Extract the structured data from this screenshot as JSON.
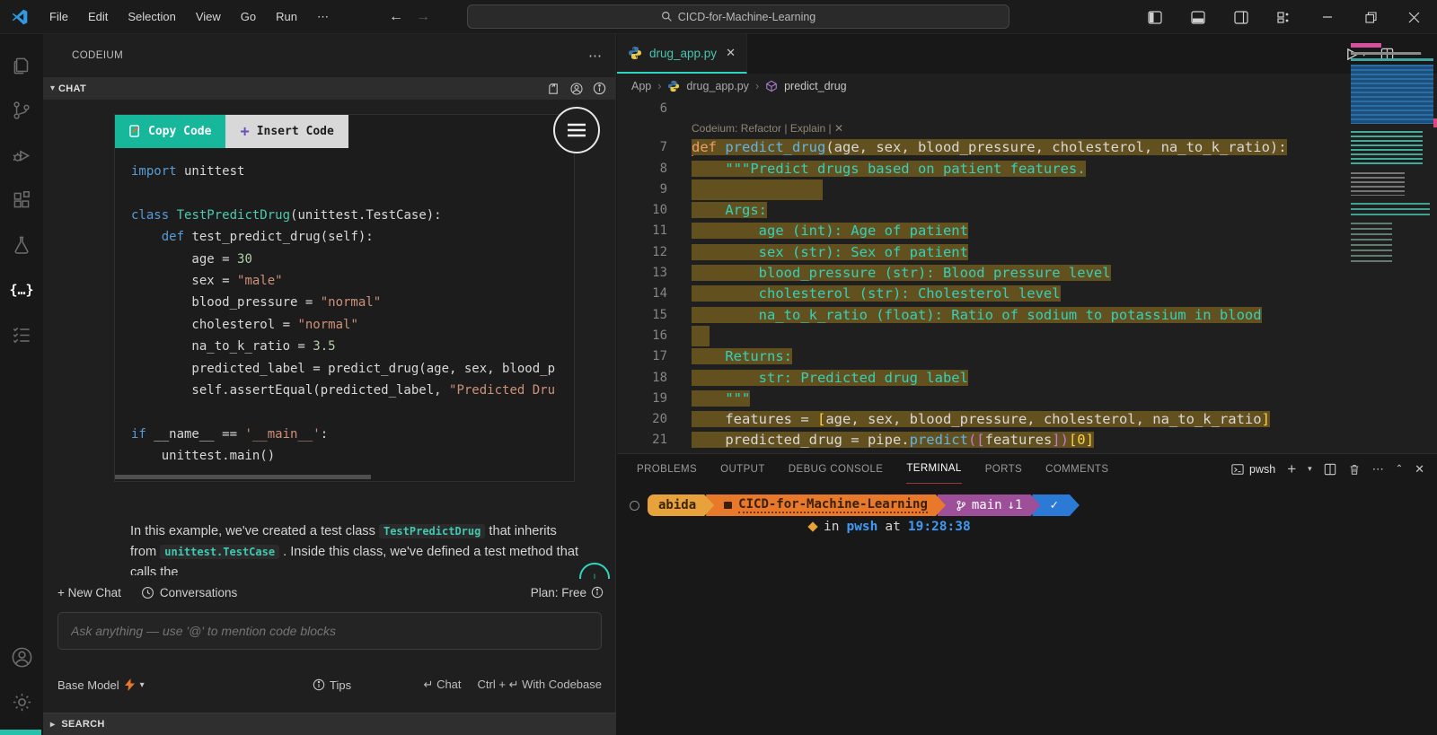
{
  "titlebar": {
    "menus": [
      "File",
      "Edit",
      "Selection",
      "View",
      "Go",
      "Run"
    ],
    "overflow": "⋯",
    "search_text": "CICD-for-Machine-Learning"
  },
  "sidebar": {
    "title": "CODEIUM",
    "section_label": "CHAT",
    "code_card": {
      "copy_label": "Copy Code",
      "insert_label": "Insert Code",
      "lines": [
        {
          "parts": [
            [
              "kw",
              "import"
            ],
            [
              "pl",
              " unittest"
            ]
          ]
        },
        {
          "parts": []
        },
        {
          "parts": [
            [
              "kw",
              "class"
            ],
            [
              "pl",
              " "
            ],
            [
              "cls",
              "TestPredictDrug"
            ],
            [
              "pl",
              "(unittest.TestCase):"
            ]
          ]
        },
        {
          "parts": [
            [
              "pl",
              "    "
            ],
            [
              "kw",
              "def"
            ],
            [
              "pl",
              " test_predict_drug(self):"
            ]
          ]
        },
        {
          "parts": [
            [
              "pl",
              "        age = "
            ],
            [
              "num",
              "30"
            ]
          ]
        },
        {
          "parts": [
            [
              "pl",
              "        sex = "
            ],
            [
              "str",
              "\"male\""
            ]
          ]
        },
        {
          "parts": [
            [
              "pl",
              "        blood_pressure = "
            ],
            [
              "str",
              "\"normal\""
            ]
          ]
        },
        {
          "parts": [
            [
              "pl",
              "        cholesterol = "
            ],
            [
              "str",
              "\"normal\""
            ]
          ]
        },
        {
          "parts": [
            [
              "pl",
              "        na_to_k_ratio = "
            ],
            [
              "num",
              "3.5"
            ]
          ]
        },
        {
          "parts": [
            [
              "pl",
              "        predicted_label = predict_drug(age, sex, blood_p"
            ]
          ]
        },
        {
          "parts": [
            [
              "pl",
              "        self.assertEqual(predicted_label, "
            ],
            [
              "str",
              "\"Predicted Dru"
            ]
          ]
        },
        {
          "parts": []
        },
        {
          "parts": [
            [
              "kw",
              "if"
            ],
            [
              "pl",
              " __name__ == "
            ],
            [
              "str",
              "'__main__'"
            ],
            [
              "pl",
              ":"
            ]
          ]
        },
        {
          "parts": [
            [
              "pl",
              "    unittest.main()"
            ]
          ]
        }
      ]
    },
    "explanation": [
      {
        "code": false,
        "text": "In this example, we've created a test class "
      },
      {
        "code": true,
        "text": "TestPredictDrug"
      },
      {
        "code": false,
        "text": " that inherits from "
      },
      {
        "code": true,
        "text": "unittest.TestCase"
      },
      {
        "code": false,
        "text": " . Inside this class, we've defined a test method that calls the"
      }
    ],
    "footer": {
      "new_chat": "+ New Chat",
      "conversations": "Conversations",
      "plan": "Plan: Free"
    },
    "input_placeholder": "Ask anything — use '@' to mention code blocks",
    "bottom": {
      "model": "Base Model",
      "tips": "Tips",
      "chat": "Chat",
      "ctrl": "Ctrl +",
      "with_codebase": "With Codebase"
    },
    "search_section": "SEARCH"
  },
  "editor": {
    "tab_label": "drug_app.py",
    "breadcrumb": {
      "root": "App",
      "file": "drug_app.py",
      "symbol": "predict_drug"
    },
    "codelens": "Codeium: Refactor | Explain | ✕",
    "lines": [
      {
        "n": 6,
        "parts": []
      },
      {
        "n": 7,
        "lens": true,
        "hl": true,
        "cursor": true,
        "parts": [
          [
            "okw",
            "def"
          ],
          [
            "pl",
            " "
          ],
          [
            "fn",
            "predict_drug"
          ],
          [
            "pl",
            "(age, sex, blood_pressure, cholesterol, na_to_k_ratio):"
          ]
        ]
      },
      {
        "n": 8,
        "hl": true,
        "parts": [
          [
            "pl",
            "    "
          ],
          [
            "doc",
            "\"\"\"Predict drugs based on patient features."
          ]
        ]
      },
      {
        "n": 9,
        "hl": true,
        "block": 146,
        "parts": []
      },
      {
        "n": 10,
        "hl": true,
        "parts": [
          [
            "pl",
            "    "
          ],
          [
            "doc",
            "Args:"
          ]
        ]
      },
      {
        "n": 11,
        "hl": true,
        "parts": [
          [
            "pl",
            "        "
          ],
          [
            "doc",
            "age (int): Age of patient"
          ]
        ]
      },
      {
        "n": 12,
        "hl": true,
        "parts": [
          [
            "pl",
            "        "
          ],
          [
            "doc",
            "sex (str): Sex of patient"
          ]
        ]
      },
      {
        "n": 13,
        "hl": true,
        "parts": [
          [
            "pl",
            "        "
          ],
          [
            "doc",
            "blood_pressure (str): Blood pressure level"
          ]
        ]
      },
      {
        "n": 14,
        "hl": true,
        "parts": [
          [
            "pl",
            "        "
          ],
          [
            "doc",
            "cholesterol (str): Cholesterol level"
          ]
        ]
      },
      {
        "n": 15,
        "hl": true,
        "parts": [
          [
            "pl",
            "        "
          ],
          [
            "doc",
            "na_to_k_ratio (float): Ratio of sodium to potassium in blood"
          ]
        ]
      },
      {
        "n": 16,
        "hl": true,
        "block": 20,
        "parts": []
      },
      {
        "n": 17,
        "hl": true,
        "parts": [
          [
            "pl",
            "    "
          ],
          [
            "doc",
            "Returns:"
          ]
        ]
      },
      {
        "n": 18,
        "hl": true,
        "parts": [
          [
            "pl",
            "        "
          ],
          [
            "doc",
            "str: Predicted drug label"
          ]
        ]
      },
      {
        "n": 19,
        "hl": true,
        "parts": [
          [
            "pl",
            "    "
          ],
          [
            "doc",
            "\"\"\""
          ]
        ]
      },
      {
        "n": 20,
        "hl": true,
        "parts": [
          [
            "pl",
            "    features = "
          ],
          [
            "brY",
            "["
          ],
          [
            "pl",
            "age, sex, blood_pressure, cholesterol, na_to_k_ratio"
          ],
          [
            "brY",
            "]"
          ]
        ]
      },
      {
        "n": 21,
        "hl": true,
        "parts": [
          [
            "pl",
            "    predicted_drug = pipe."
          ],
          [
            "fn",
            "predict"
          ],
          [
            "brP",
            "(["
          ],
          [
            "pl",
            "features"
          ],
          [
            "brP",
            "])"
          ],
          [
            "brY",
            "[0]"
          ]
        ]
      }
    ]
  },
  "panel": {
    "tabs": [
      "PROBLEMS",
      "OUTPUT",
      "DEBUG CONSOLE",
      "TERMINAL",
      "PORTS",
      "COMMENTS"
    ],
    "active_tab": "TERMINAL",
    "shell_label": "pwsh",
    "prompt": {
      "user": "abida",
      "repo": "CICD-for-Machine-Learning",
      "branch": "main",
      "behind": "↓1",
      "check": "✓",
      "line2_in": "in",
      "line2_shell": "pwsh",
      "line2_at": "at",
      "line2_time": "19:28:38"
    }
  },
  "colors": {
    "accent_teal": "#2dd4bf",
    "codeium_teal": "#16b79b",
    "selection_brown": "#63501f",
    "prompt_amber": "#e7a23c",
    "prompt_orange": "#e8782a",
    "prompt_purple": "#9d4f9a",
    "prompt_blue": "#2b7ad6"
  }
}
